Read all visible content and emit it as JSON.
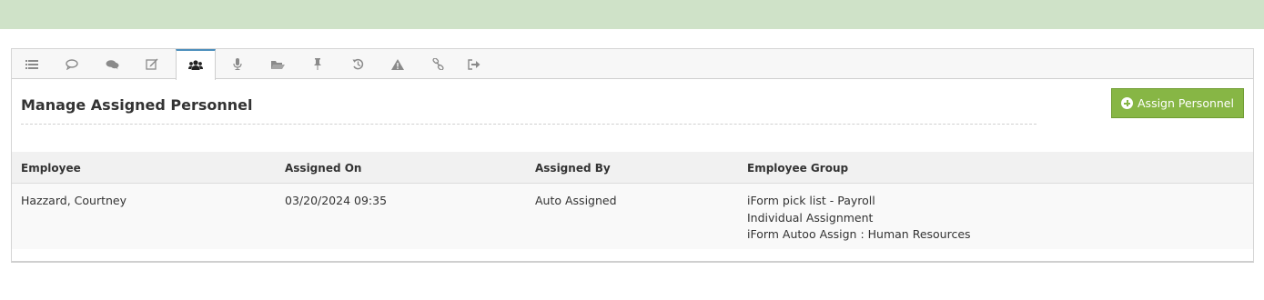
{
  "tabs": [
    {
      "name": "tab-list",
      "icon": "list-icon"
    },
    {
      "name": "tab-comment",
      "icon": "comment-outline-icon"
    },
    {
      "name": "tab-comments",
      "icon": "comments-icon"
    },
    {
      "name": "tab-edit",
      "icon": "edit-icon"
    },
    {
      "name": "tab-personnel",
      "icon": "users-icon",
      "active": true
    },
    {
      "name": "tab-audio",
      "icon": "microphone-icon"
    },
    {
      "name": "tab-files",
      "icon": "folder-open-icon"
    },
    {
      "name": "tab-pin",
      "icon": "pushpin-icon"
    },
    {
      "name": "tab-history",
      "icon": "history-icon"
    },
    {
      "name": "tab-warning",
      "icon": "warning-icon"
    },
    {
      "name": "tab-links",
      "icon": "link-icon"
    },
    {
      "name": "tab-exit",
      "icon": "sign-out-icon"
    }
  ],
  "section": {
    "title": "Manage Assigned Personnel"
  },
  "actions": {
    "assign_label": "Assign Personnel",
    "assign_icon": "plus-circle-icon"
  },
  "table": {
    "headers": [
      "Employee",
      "Assigned On",
      "Assigned By",
      "Employee Group"
    ],
    "rows": [
      {
        "employee": "Hazzard, Courtney",
        "assigned_on": "03/20/2024 09:35",
        "assigned_by": "Auto Assigned",
        "groups": [
          "iForm pick list - Payroll",
          "Individual Assignment",
          "iForm Autoo Assign : Human Resources"
        ]
      }
    ]
  },
  "colors": {
    "banner": "#cfe2c8",
    "accent_button": "#87b645",
    "active_tab_border": "#4c8fbd"
  }
}
